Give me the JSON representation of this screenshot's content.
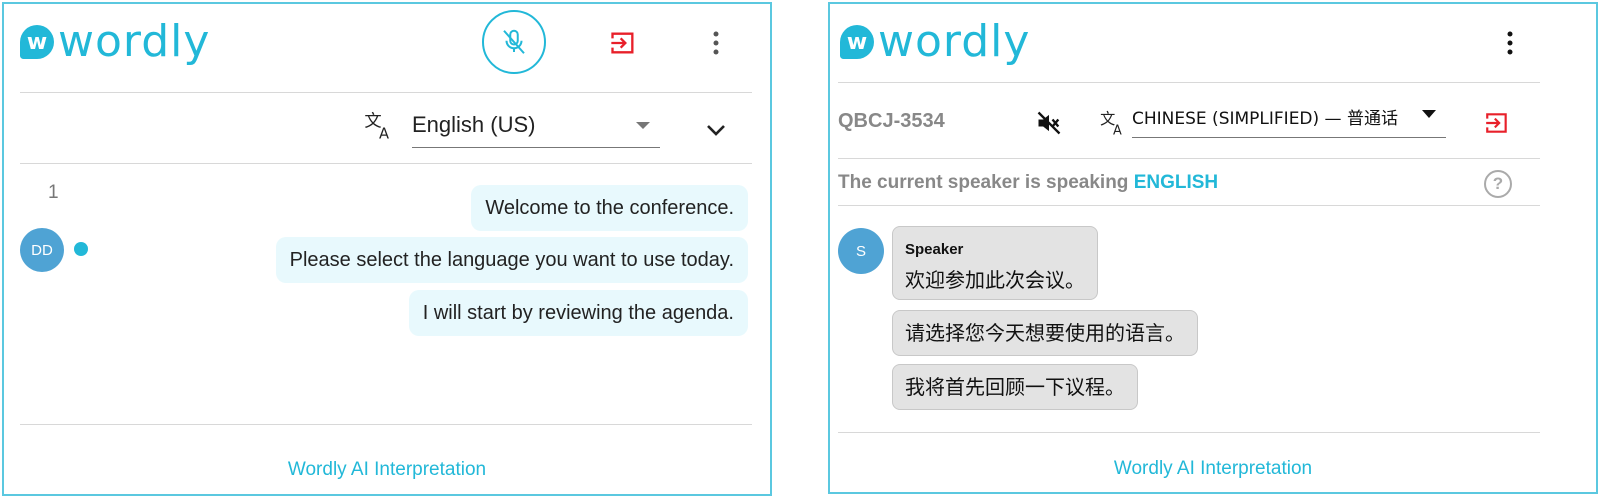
{
  "left_panel": {
    "logo": {
      "badge": "w",
      "text": "wordly"
    },
    "language": {
      "selected": "English (US)"
    },
    "messages": {
      "block_number": "1",
      "avatar_initials": "DD",
      "items": [
        "Welcome to the conference.",
        "Please select the language you want to use today.",
        "I will start by reviewing the agenda."
      ]
    },
    "footer": "Wordly AI Interpretation",
    "icons": [
      "mic-muted-icon",
      "exit-icon",
      "more-vertical-icon",
      "translate-icon",
      "chevron-down-icon"
    ]
  },
  "right_panel": {
    "logo": {
      "badge": "w",
      "text": "wordly"
    },
    "session_code": "QBCJ-3534",
    "language": {
      "selected": "CHINESE (SIMPLIFIED) — 普通话"
    },
    "speaker_status": {
      "prefix": "The current speaker is speaking",
      "language": "ENGLISH"
    },
    "messages": {
      "avatar_initial": "S",
      "speaker_name": "Speaker",
      "items": [
        "欢迎参加此次会议。",
        "请选择您今天想要使用的语言。",
        "我将首先回顾一下议程。"
      ]
    },
    "footer": "Wordly AI Interpretation",
    "icons": [
      "more-vertical-icon",
      "speaker-muted-icon",
      "translate-icon",
      "dropdown-arrow-icon",
      "exit-icon",
      "help-icon"
    ]
  },
  "colors": {
    "accent": "#22b8d8",
    "exit": "#e8202a",
    "bubble_blue": "#e8f9fd",
    "bubble_gray": "#e3e3e3"
  }
}
